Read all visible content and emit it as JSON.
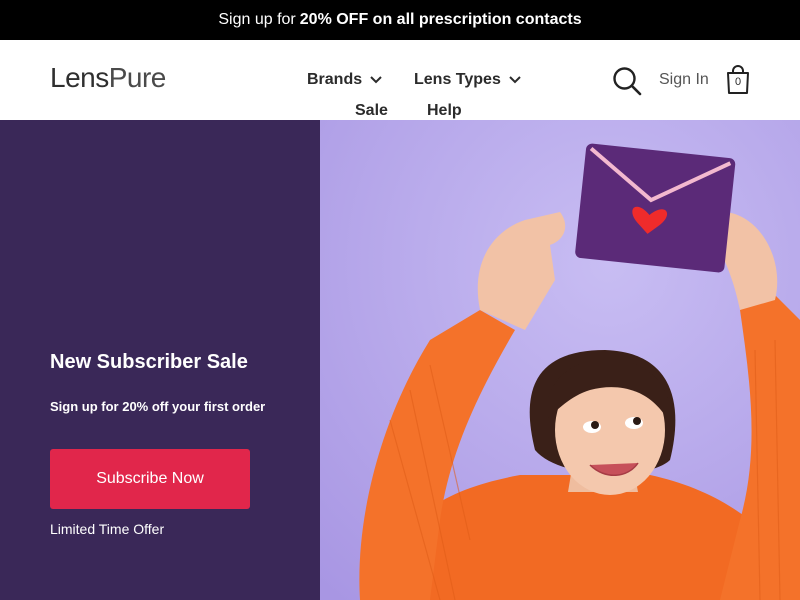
{
  "promo": {
    "prefix": "Sign up for",
    "highlight": "20% OFF on all prescription contacts"
  },
  "header": {
    "logo_part1": "Lens",
    "logo_part2": "Pure",
    "nav": {
      "brands": "Brands",
      "lens_types": "Lens Types",
      "sale": "Sale",
      "help": "Help"
    },
    "sign_in": "Sign In",
    "cart_count": "0"
  },
  "hero": {
    "title": "New Subscriber Sale",
    "subtitle": "Sign up for 20% off your first order",
    "cta_label": "Subscribe Now",
    "note": "Limited Time Offer"
  },
  "colors": {
    "promo_bg": "#000000",
    "hero_left_bg": "#3a2858",
    "hero_right_bg": "#b9a9ec",
    "cta_bg": "#e1264b"
  },
  "icons": [
    "search-icon",
    "shopping-bag-icon",
    "chevron-down-icon"
  ]
}
